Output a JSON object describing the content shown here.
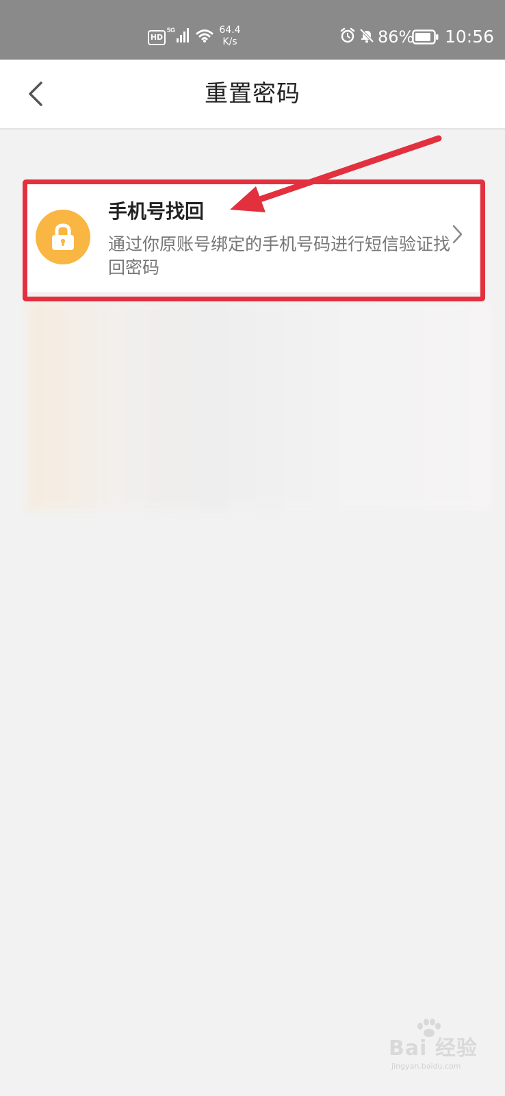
{
  "status_bar": {
    "hd_label": "HD",
    "network_type": "5G",
    "net_speed_value": "64.4",
    "net_speed_unit": "K/s",
    "battery": "86%",
    "time": "10:56"
  },
  "nav": {
    "title": "重置密码"
  },
  "options": [
    {
      "title": "手机号找回",
      "description": "通过你原账号绑定的手机号码进行短信验证找回密码",
      "icon": "lock-icon"
    }
  ],
  "watermark": {
    "text": "Bai 经验",
    "url": "jingyan.baidu.com"
  },
  "colors": {
    "accent_icon_bg": "#f9b642",
    "annotation_red": "#e2303f",
    "status_bar_bg": "#8a8a8a"
  }
}
